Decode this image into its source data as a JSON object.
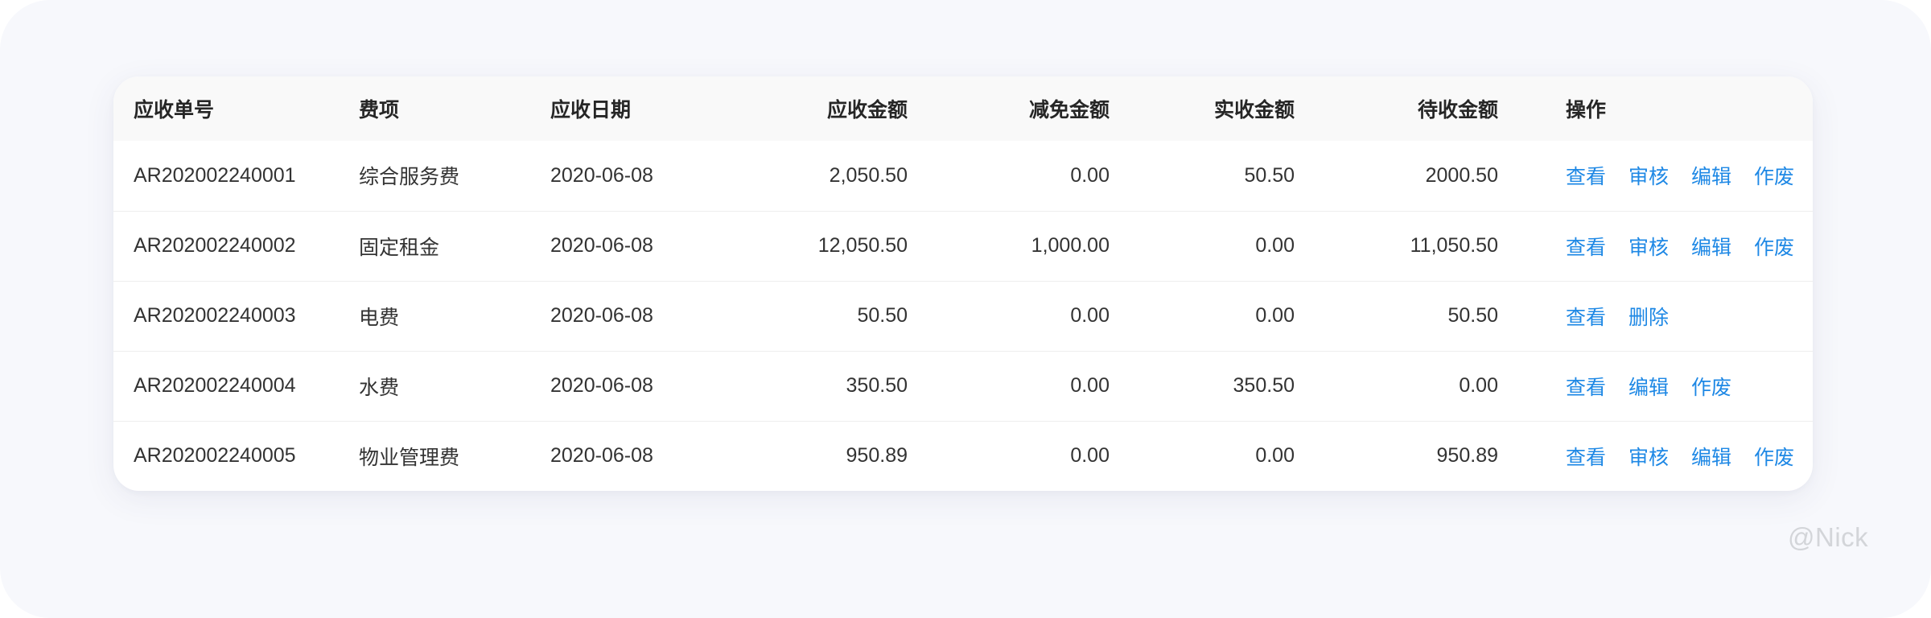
{
  "table": {
    "columns": [
      "应收单号",
      "费项",
      "应收日期",
      "应收金额",
      "减免金额",
      "实收金额",
      "待收金额",
      "操作"
    ],
    "rows": [
      {
        "id": "AR202002240001",
        "item": "综合服务费",
        "date": "2020-06-08",
        "receivable": "2,050.50",
        "discount": "0.00",
        "received": "50.50",
        "pending": "2000.50",
        "actions": [
          "查看",
          "审核",
          "编辑",
          "作废"
        ]
      },
      {
        "id": "AR202002240002",
        "item": "固定租金",
        "date": "2020-06-08",
        "receivable": "12,050.50",
        "discount": "1,000.00",
        "received": "0.00",
        "pending": "11,050.50",
        "actions": [
          "查看",
          "审核",
          "编辑",
          "作废"
        ]
      },
      {
        "id": "AR202002240003",
        "item": "电费",
        "date": "2020-06-08",
        "receivable": "50.50",
        "discount": "0.00",
        "received": "0.00",
        "pending": "50.50",
        "actions": [
          "查看",
          "删除"
        ]
      },
      {
        "id": "AR202002240004",
        "item": "水费",
        "date": "2020-06-08",
        "receivable": "350.50",
        "discount": "0.00",
        "received": "350.50",
        "pending": "0.00",
        "actions": [
          "查看",
          "编辑",
          "作废"
        ]
      },
      {
        "id": "AR202002240005",
        "item": "物业管理费",
        "date": "2020-06-08",
        "receivable": "950.89",
        "discount": "0.00",
        "received": "0.00",
        "pending": "950.89",
        "actions": [
          "查看",
          "审核",
          "编辑",
          "作废"
        ]
      }
    ]
  },
  "watermark": "@Nick",
  "colors": {
    "link": "#1e88e5",
    "header_bg": "#f9f9f9",
    "page_bg": "#f7f8fc"
  }
}
